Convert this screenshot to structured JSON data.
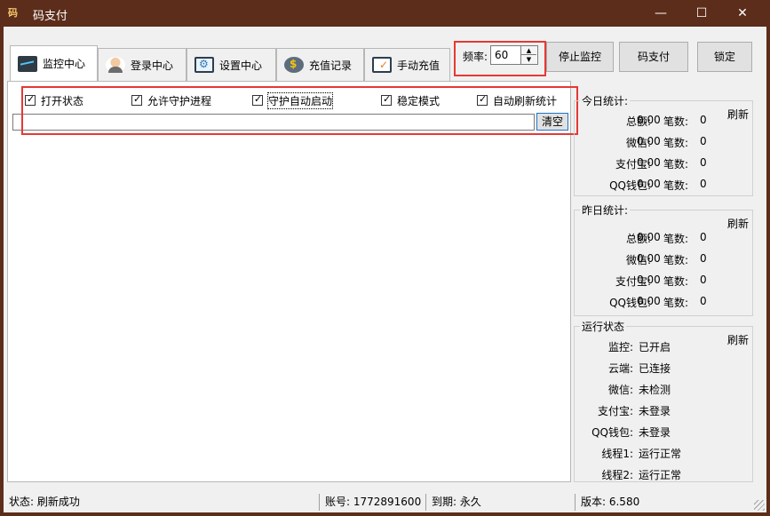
{
  "window": {
    "title": "码支付",
    "app_icon_text": "码",
    "controls": {
      "minimize": "—",
      "maximize": "☐",
      "close": "✕"
    }
  },
  "tabs": [
    {
      "label": "监控中心",
      "icon": "monitor-icon",
      "active": true
    },
    {
      "label": "登录中心",
      "icon": "user-icon",
      "active": false
    },
    {
      "label": "设置中心",
      "icon": "settings-icon",
      "active": false
    },
    {
      "label": "充值记录",
      "icon": "coin-icon",
      "active": false
    },
    {
      "label": "手动充值",
      "icon": "manual-recharge-icon",
      "active": false
    }
  ],
  "toolbar": {
    "frequency_label": "频率:",
    "frequency_value": "60",
    "stop_monitor_label": "停止监控",
    "code_pay_label": "码支付",
    "lock_label": "锁定"
  },
  "options": [
    {
      "label": "打开状态",
      "checked": true
    },
    {
      "label": "允许守护进程",
      "checked": true
    },
    {
      "label": "守护自动启动",
      "checked": true
    },
    {
      "label": "稳定模式",
      "checked": true
    },
    {
      "label": "自动刷新统计",
      "checked": true
    }
  ],
  "log": {
    "input_value": "",
    "clear_label": "清空"
  },
  "today_stats": {
    "title": "今日统计:",
    "refresh_label": "刷新",
    "rows": [
      {
        "label": "总额:",
        "amount": "0.00",
        "count_label": "笔数:",
        "count": "0"
      },
      {
        "label": "微信:",
        "amount": "0.00",
        "count_label": "笔数:",
        "count": "0"
      },
      {
        "label": "支付宝:",
        "amount": "0.00",
        "count_label": "笔数:",
        "count": "0"
      },
      {
        "label": "QQ钱包:",
        "amount": "0.00",
        "count_label": "笔数:",
        "count": "0"
      }
    ]
  },
  "yesterday_stats": {
    "title": "昨日统计:",
    "refresh_label": "刷新",
    "rows": [
      {
        "label": "总额:",
        "amount": "0.00",
        "count_label": "笔数:",
        "count": "0"
      },
      {
        "label": "微信:",
        "amount": "0.00",
        "count_label": "笔数:",
        "count": "0"
      },
      {
        "label": "支付宝:",
        "amount": "0.00",
        "count_label": "笔数:",
        "count": "0"
      },
      {
        "label": "QQ钱包:",
        "amount": "0.00",
        "count_label": "笔数:",
        "count": "0"
      }
    ]
  },
  "run_status": {
    "title": "运行状态",
    "refresh_label": "刷新",
    "rows": [
      {
        "label": "监控:",
        "value": "已开启"
      },
      {
        "label": "云端:",
        "value": "已连接"
      },
      {
        "label": "微信:",
        "value": "未检测"
      },
      {
        "label": "支付宝:",
        "value": "未登录"
      },
      {
        "label": "QQ钱包:",
        "value": "未登录"
      },
      {
        "label": "线程1:",
        "value": "运行正常"
      },
      {
        "label": "线程2:",
        "value": "运行正常"
      }
    ]
  },
  "statusbar": {
    "status": "状态: 刷新成功",
    "account": "账号: 1772891600",
    "expiry": "到期: 永久",
    "version": "版本: 6.580"
  },
  "colors": {
    "titlebar": "#5c2d1a",
    "highlight": "#e53935",
    "window_bg": "#f0f0f0"
  }
}
